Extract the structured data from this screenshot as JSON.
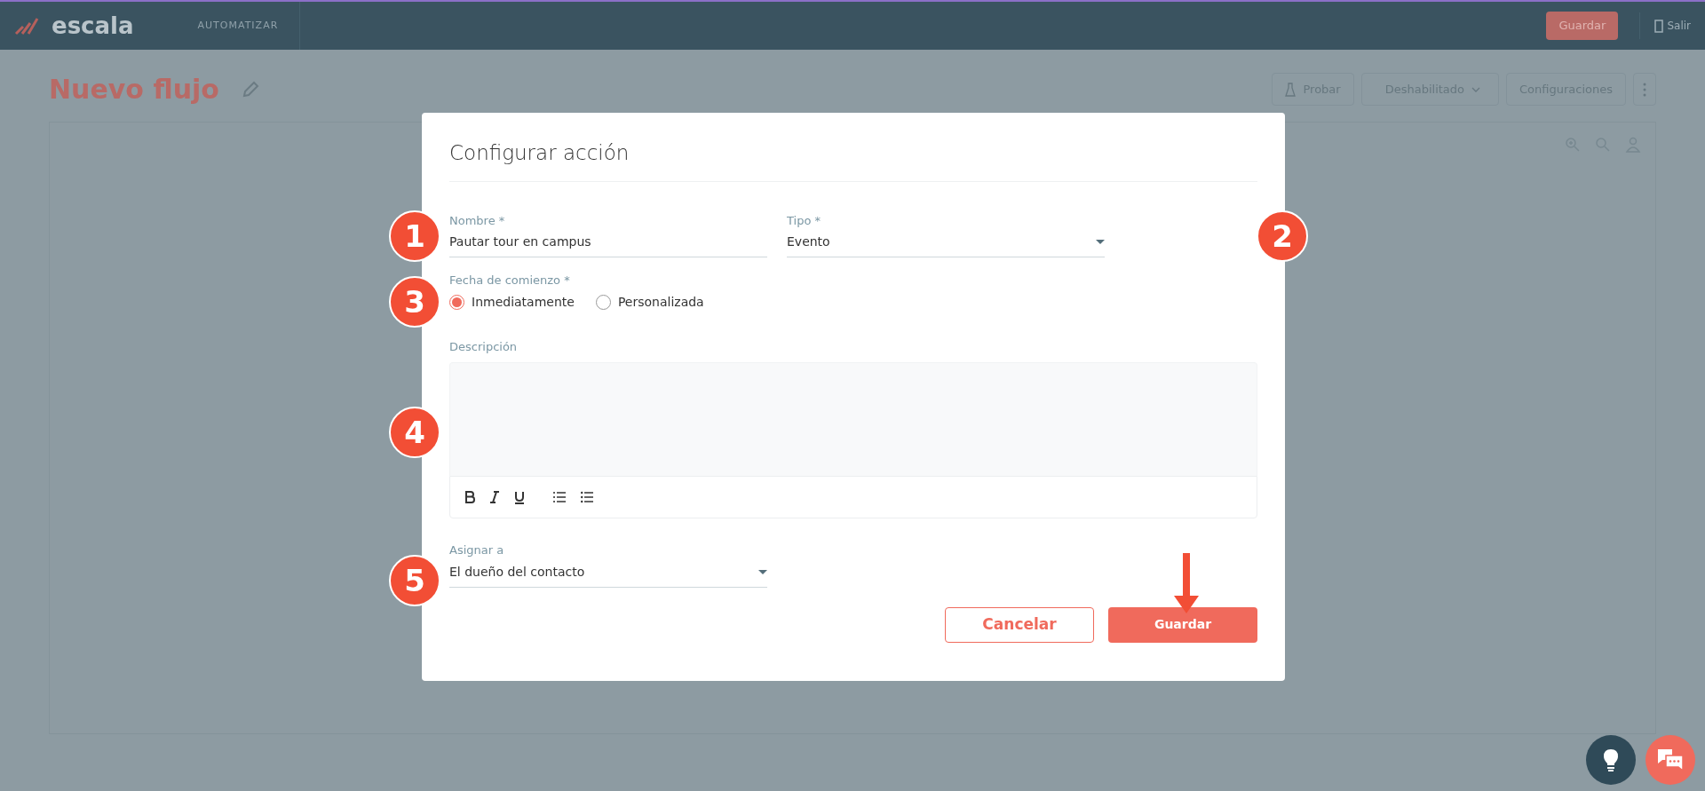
{
  "topbar": {
    "logo": "escala",
    "nav_item": "AUTOMATIZAR",
    "save_button": "Guardar",
    "exit_link": "Salir"
  },
  "page": {
    "title": "Nuevo flujo",
    "actions": [
      {
        "kind": "test",
        "label": "Probar"
      },
      {
        "kind": "dropdown",
        "label": "Deshabilitado"
      },
      {
        "kind": "plain",
        "label": "Configuraciones"
      },
      {
        "kind": "more"
      }
    ]
  },
  "modal": {
    "title": "Configurar acción",
    "name_field": {
      "label": "Nombre *",
      "value": "Pautar tour en campus"
    },
    "type_field": {
      "label": "Tipo *",
      "value": "Evento"
    },
    "start_date": {
      "label": "Fecha de comienzo *",
      "options": [
        {
          "label": "Inmediatamente",
          "selected": true
        },
        {
          "label": "Personalizada",
          "selected": false
        }
      ]
    },
    "description": {
      "label": "Descripción"
    },
    "assign_field": {
      "label": "Asignar a",
      "value": "El dueño del contacto"
    },
    "buttons": [
      {
        "kind": "secondary",
        "label": "Cancelar"
      },
      {
        "kind": "primary",
        "label": "Guardar"
      }
    ]
  },
  "annotations": [
    "1",
    "2",
    "3",
    "4",
    "5"
  ]
}
